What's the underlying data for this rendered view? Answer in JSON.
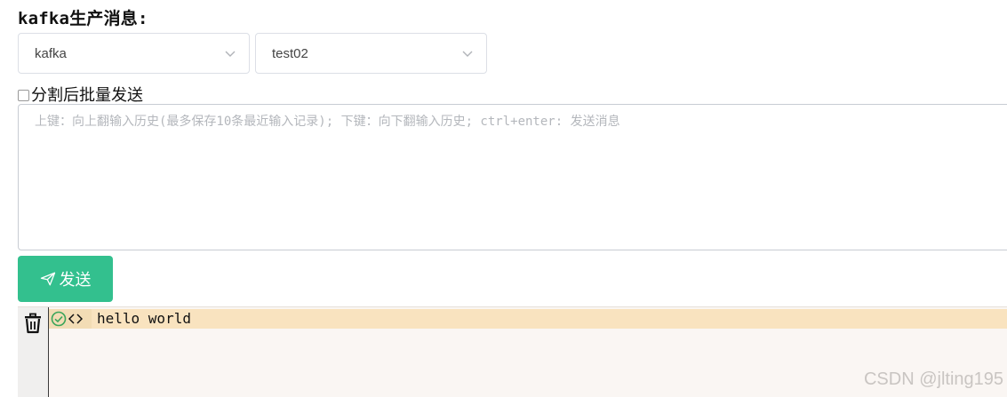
{
  "title": "kafka生产消息:",
  "selects": {
    "cluster": {
      "value": "kafka"
    },
    "topic": {
      "value": "test02"
    }
  },
  "checkbox": {
    "label": "分割后批量发送",
    "checked": false
  },
  "message_input": {
    "placeholder": "上键：向上翻输入历史(最多保存10条最近输入记录); 下键：向下翻输入历史; ctrl+enter: 发送消息",
    "value": ""
  },
  "send_button": {
    "label": "发送"
  },
  "output": {
    "messages": [
      {
        "status": "success",
        "text": "hello world"
      }
    ]
  },
  "watermark": "CSDN @jlting195",
  "colors": {
    "accent": "#33c08e",
    "success": "#3aa55a",
    "highlight_row": "#f9e3bf",
    "output_bg": "#faf6f3"
  },
  "icons": {
    "select_arrow": "chevron-down-icon",
    "send": "paper-plane-icon",
    "clear": "trash-icon",
    "status": "check-circle-icon",
    "format": "code-icon"
  }
}
